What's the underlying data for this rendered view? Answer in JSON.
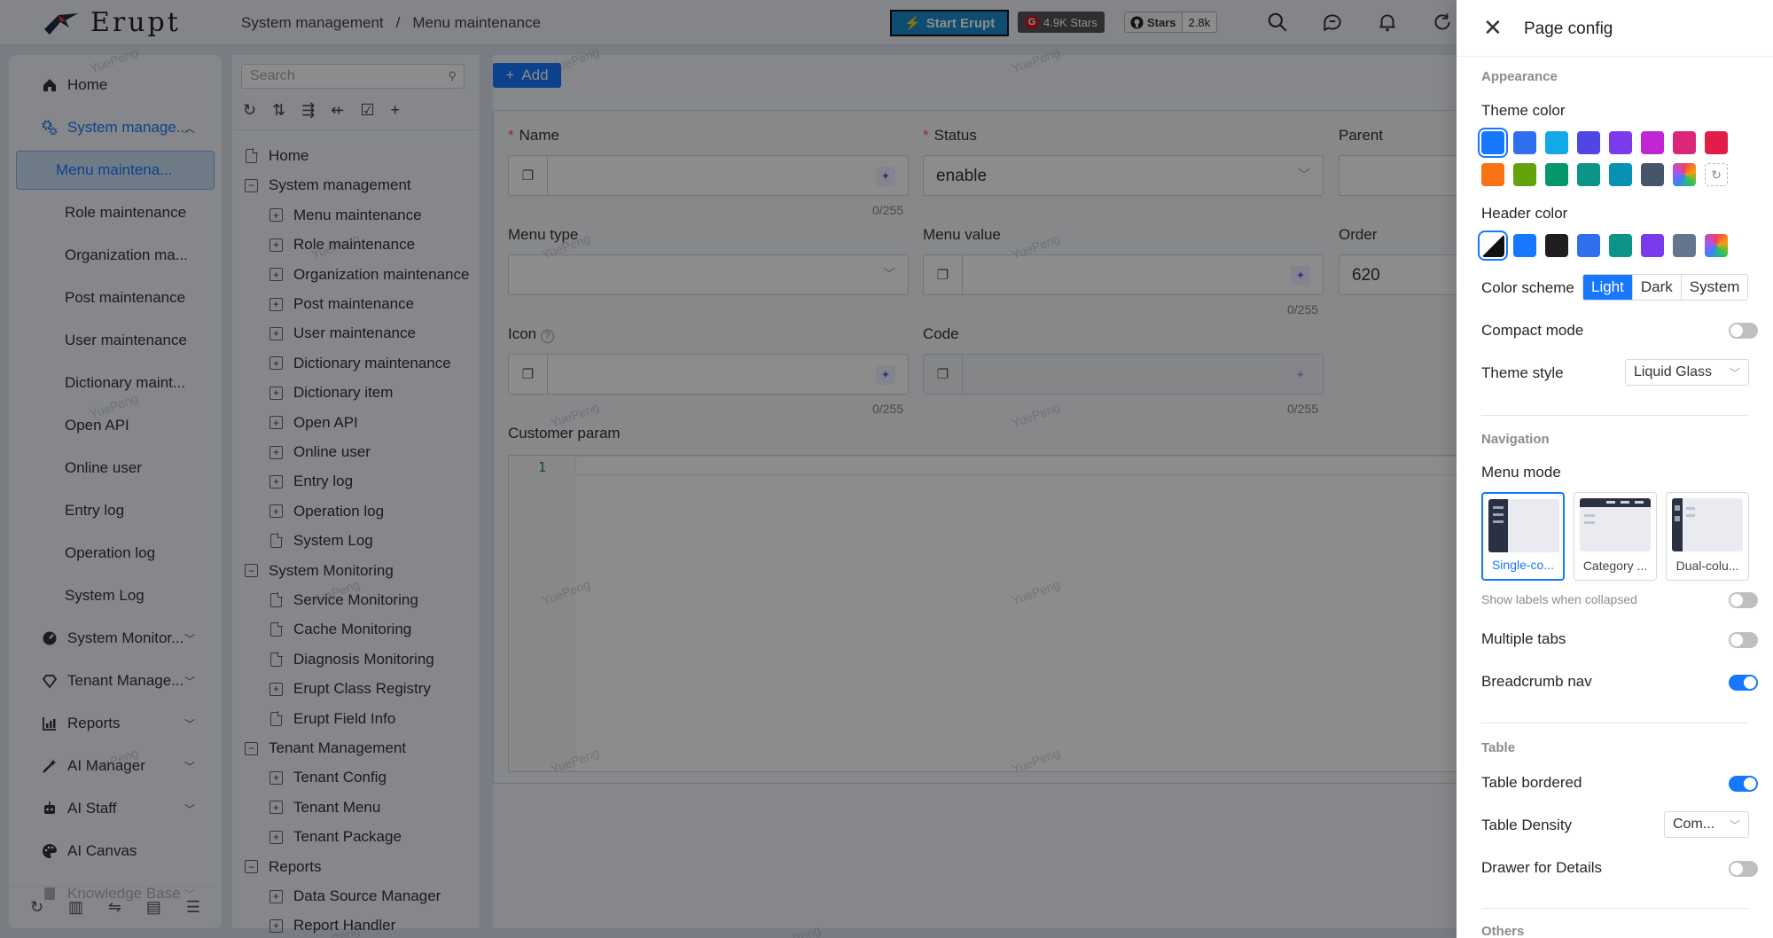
{
  "app": {
    "logo_text": "Erupt"
  },
  "header": {
    "breadcrumb": [
      "System management",
      "/",
      "Menu maintenance"
    ],
    "start_button": "Start Erupt",
    "gitee_badge": "4.9K Stars",
    "github_badge_label": "Stars",
    "github_badge_count": "2.8k"
  },
  "sidebar": {
    "items": [
      {
        "label": "Home",
        "icon": "home-icon"
      },
      {
        "label": "System manage...",
        "icon": "gears-icon",
        "expanded": true
      },
      {
        "label": "Menu maintena...",
        "selected": true
      },
      {
        "label": "Role maintenance"
      },
      {
        "label": "Organization ma..."
      },
      {
        "label": "Post maintenance"
      },
      {
        "label": "User maintenance"
      },
      {
        "label": "Dictionary maint..."
      },
      {
        "label": "Open API"
      },
      {
        "label": "Online user"
      },
      {
        "label": "Entry log"
      },
      {
        "label": "Operation log"
      },
      {
        "label": "System Log"
      },
      {
        "label": "System Monitor...",
        "icon": "dashboard-icon"
      },
      {
        "label": "Tenant Manage...",
        "icon": "diamond-icon"
      },
      {
        "label": "Reports",
        "icon": "bar-chart-icon"
      },
      {
        "label": "AI Manager",
        "icon": "magic-wand-icon"
      },
      {
        "label": "AI Staff",
        "icon": "robot-icon"
      },
      {
        "label": "AI Canvas",
        "icon": "palette-icon"
      },
      {
        "label": "Knowledge Base",
        "icon": "book-icon"
      }
    ]
  },
  "tree": {
    "search_placeholder": "Search",
    "nodes": [
      {
        "label": "Home",
        "level": 0,
        "kind": "doc"
      },
      {
        "label": "System management",
        "level": 0,
        "kind": "minus"
      },
      {
        "label": "Menu maintenance",
        "level": 1,
        "kind": "plus"
      },
      {
        "label": "Role maintenance",
        "level": 1,
        "kind": "plus"
      },
      {
        "label": "Organization maintenance",
        "level": 1,
        "kind": "plus"
      },
      {
        "label": "Post maintenance",
        "level": 1,
        "kind": "plus"
      },
      {
        "label": "User maintenance",
        "level": 1,
        "kind": "plus"
      },
      {
        "label": "Dictionary maintenance",
        "level": 1,
        "kind": "plus"
      },
      {
        "label": "Dictionary item",
        "level": 1,
        "kind": "plus"
      },
      {
        "label": "Open API",
        "level": 1,
        "kind": "plus"
      },
      {
        "label": "Online user",
        "level": 1,
        "kind": "plus"
      },
      {
        "label": "Entry log",
        "level": 1,
        "kind": "plus"
      },
      {
        "label": "Operation log",
        "level": 1,
        "kind": "plus"
      },
      {
        "label": "System Log",
        "level": 1,
        "kind": "doc"
      },
      {
        "label": "System Monitoring",
        "level": 0,
        "kind": "minus"
      },
      {
        "label": "Service Monitoring",
        "level": 1,
        "kind": "doc"
      },
      {
        "label": "Cache Monitoring",
        "level": 1,
        "kind": "doc"
      },
      {
        "label": "Diagnosis Monitoring",
        "level": 1,
        "kind": "doc"
      },
      {
        "label": "Erupt Class Registry",
        "level": 1,
        "kind": "plus"
      },
      {
        "label": "Erupt Field Info",
        "level": 1,
        "kind": "doc"
      },
      {
        "label": "Tenant Management",
        "level": 0,
        "kind": "minus"
      },
      {
        "label": "Tenant Config",
        "level": 1,
        "kind": "plus"
      },
      {
        "label": "Tenant Menu",
        "level": 1,
        "kind": "plus"
      },
      {
        "label": "Tenant Package",
        "level": 1,
        "kind": "plus"
      },
      {
        "label": "Reports",
        "level": 0,
        "kind": "minus"
      },
      {
        "label": "Data Source Manager",
        "level": 1,
        "kind": "plus"
      },
      {
        "label": "Report Handler",
        "level": 1,
        "kind": "plus"
      }
    ]
  },
  "form": {
    "add_label": "Add",
    "name_label": "Name",
    "status_label": "Status",
    "status_value": "enable",
    "parent_label": "Parent",
    "menu_type_label": "Menu type",
    "menu_value_label": "Menu value",
    "order_label": "Order",
    "order_value": "620",
    "icon_label": "Icon",
    "code_label": "Code",
    "customer_param_label": "Customer param",
    "counter": "0/255",
    "line_number": "1"
  },
  "watermark": "YuePeng",
  "drawer": {
    "title": "Page config",
    "appearance": "Appearance",
    "theme_color": "Theme color",
    "theme_colors": [
      "#1677ff",
      "#2f6fee",
      "#13a8e8",
      "#4f46e5",
      "#7c3aed",
      "#c026d3",
      "#db2777",
      "#e11d48",
      "#f97316",
      "#65a30d",
      "#059669",
      "#0d9488",
      "#0891b2",
      "#475569",
      "rainbow",
      "custom"
    ],
    "header_color": "Header color",
    "header_colors": [
      "auto",
      "#1677ff",
      "#1f1f1f",
      "#2f6fee",
      "#0d9488",
      "#7c3aed",
      "#64748b",
      "rainbow"
    ],
    "color_scheme": "Color scheme",
    "scheme_options": [
      "Light",
      "Dark",
      "System"
    ],
    "compact_mode": "Compact mode",
    "theme_style": "Theme style",
    "theme_style_value": "Liquid Glass",
    "navigation": "Navigation",
    "menu_mode": "Menu mode",
    "menu_modes": [
      "Single-co...",
      "Category ...",
      "Dual-colu..."
    ],
    "show_labels": "Show labels when collapsed",
    "multiple_tabs": "Multiple tabs",
    "breadcrumb_nav": "Breadcrumb nav",
    "table": "Table",
    "table_bordered": "Table bordered",
    "table_density": "Table Density",
    "table_density_value": "Com...",
    "drawer_details": "Drawer for Details",
    "others": "Others"
  }
}
